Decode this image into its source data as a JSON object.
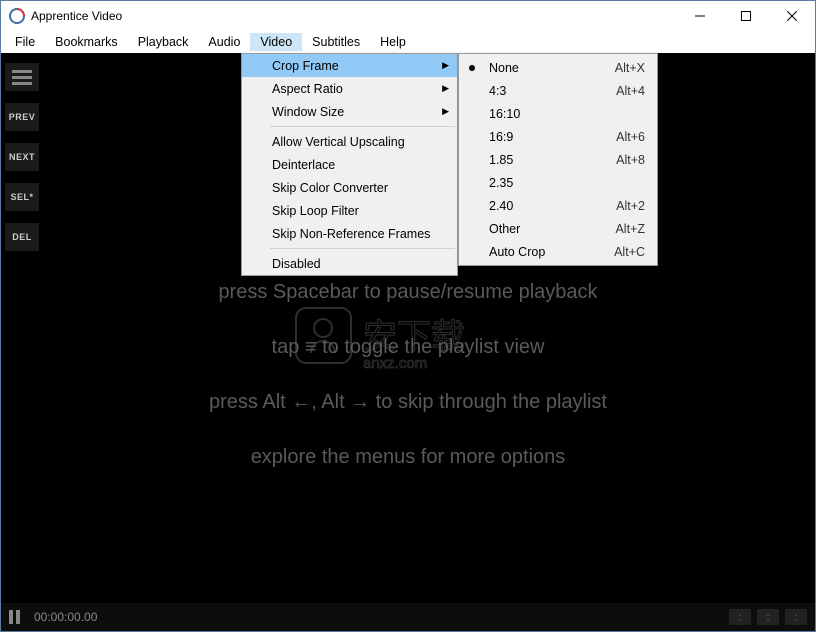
{
  "window": {
    "title": "Apprentice Video"
  },
  "menubar": [
    "File",
    "Bookmarks",
    "Playback",
    "Audio",
    "Video",
    "Subtitles",
    "Help"
  ],
  "active_menu_index": 4,
  "sidebar": {
    "prev": "PREV",
    "next": "NEXT",
    "sel": "SEL*",
    "del": "DEL"
  },
  "hints": [
    "press Spacebar to pause/resume playback",
    "tap ≡ to toggle the playlist view",
    "press Alt ←, Alt → to skip through the playlist",
    "explore the menus for more options"
  ],
  "video_menu": {
    "group1": [
      {
        "label": "Crop Frame",
        "sub": true,
        "hl": true
      },
      {
        "label": "Aspect Ratio",
        "sub": true
      },
      {
        "label": "Window Size",
        "sub": true
      }
    ],
    "group2": [
      {
        "label": "Allow Vertical Upscaling"
      },
      {
        "label": "Deinterlace"
      },
      {
        "label": "Skip Color Converter"
      },
      {
        "label": "Skip Loop Filter"
      },
      {
        "label": "Skip Non-Reference Frames"
      }
    ],
    "group3": [
      {
        "label": "Disabled"
      }
    ]
  },
  "crop_submenu": [
    {
      "label": "None",
      "accel": "Alt+X",
      "selected": true
    },
    {
      "label": "4:3",
      "accel": "Alt+4"
    },
    {
      "label": "16:10",
      "accel": ""
    },
    {
      "label": "16:9",
      "accel": "Alt+6"
    },
    {
      "label": "1.85",
      "accel": "Alt+8"
    },
    {
      "label": "2.35",
      "accel": ""
    },
    {
      "label": "2.40",
      "accel": "Alt+2"
    },
    {
      "label": "Other",
      "accel": "Alt+Z"
    },
    {
      "label": "Auto Crop",
      "accel": "Alt+C"
    }
  ],
  "timecode": "00:00:00.00",
  "right_slots": [
    ":",
    ":",
    ":"
  ]
}
